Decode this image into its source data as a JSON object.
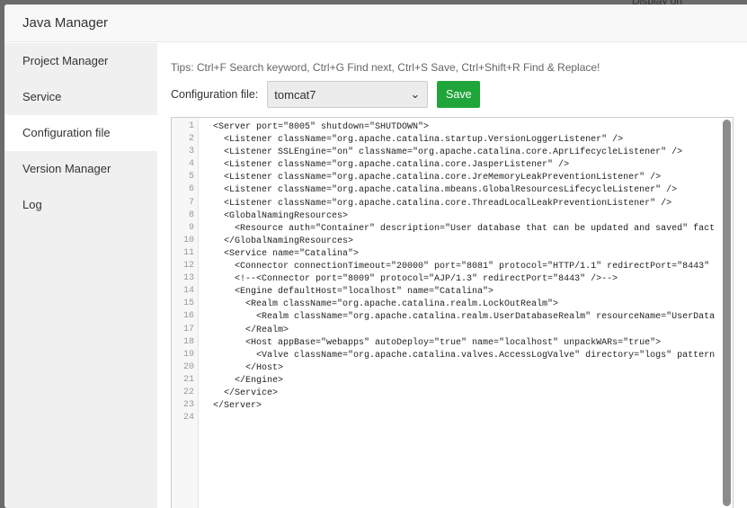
{
  "background": {
    "text": "Display on"
  },
  "window": {
    "title": "Java Manager"
  },
  "sidebar": {
    "items": [
      {
        "label": "Project Manager"
      },
      {
        "label": "Service"
      },
      {
        "label": "Configuration file"
      },
      {
        "label": "Version Manager"
      },
      {
        "label": "Log"
      }
    ],
    "active": 2
  },
  "tips": "Tips: Ctrl+F Search keyword, Ctrl+G Find next, Ctrl+S Save, Ctrl+Shift+R Find & Replace!",
  "config": {
    "label": "Configuration file:",
    "selected": "tomcat7",
    "save_label": "Save"
  },
  "editor": {
    "lines": [
      "<Server port=\"8005\" shutdown=\"SHUTDOWN\">",
      "  <Listener className=\"org.apache.catalina.startup.VersionLoggerListener\" />",
      "  <Listener SSLEngine=\"on\" className=\"org.apache.catalina.core.AprLifecycleListener\" />",
      "  <Listener className=\"org.apache.catalina.core.JasperListener\" />",
      "  <Listener className=\"org.apache.catalina.core.JreMemoryLeakPreventionListener\" />",
      "  <Listener className=\"org.apache.catalina.mbeans.GlobalResourcesLifecycleListener\" />",
      "  <Listener className=\"org.apache.catalina.core.ThreadLocalLeakPreventionListener\" />",
      "  <GlobalNamingResources>",
      "    <Resource auth=\"Container\" description=\"User database that can be updated and saved\" fact",
      "  </GlobalNamingResources>",
      "  <Service name=\"Catalina\">",
      "    <Connector connectionTimeout=\"20000\" port=\"8081\" protocol=\"HTTP/1.1\" redirectPort=\"8443\"",
      "    <!--<Connector port=\"8009\" protocol=\"AJP/1.3\" redirectPort=\"8443\" />-->",
      "    <Engine defaultHost=\"localhost\" name=\"Catalina\">",
      "      <Realm className=\"org.apache.catalina.realm.LockOutRealm\">",
      "        <Realm className=\"org.apache.catalina.realm.UserDatabaseRealm\" resourceName=\"UserData",
      "      </Realm>",
      "      <Host appBase=\"webapps\" autoDeploy=\"true\" name=\"localhost\" unpackWARs=\"true\">",
      "        <Valve className=\"org.apache.catalina.valves.AccessLogValve\" directory=\"logs\" pattern",
      "      </Host>",
      "    </Engine>",
      "  </Service>",
      "</Server>",
      ""
    ]
  }
}
